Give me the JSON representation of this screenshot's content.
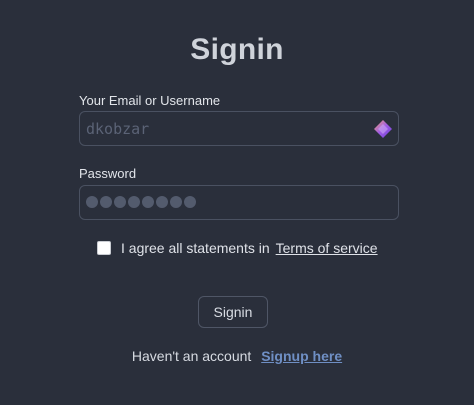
{
  "page": {
    "title": "Signin"
  },
  "form": {
    "email_label": "Your Email or Username",
    "email_value": "dkobzar",
    "password_label": "Password",
    "password_dots": 8,
    "agree_text": "I agree all statements in",
    "terms_link": "Terms of service",
    "signin_button": "Signin"
  },
  "footer": {
    "text": "Haven't an account",
    "signup_link": "Signup here"
  },
  "colors": {
    "background": "#2a2f3b",
    "link": "#6f8fc4"
  },
  "icons": {
    "email_field_icon": "password-manager-extension-icon"
  }
}
